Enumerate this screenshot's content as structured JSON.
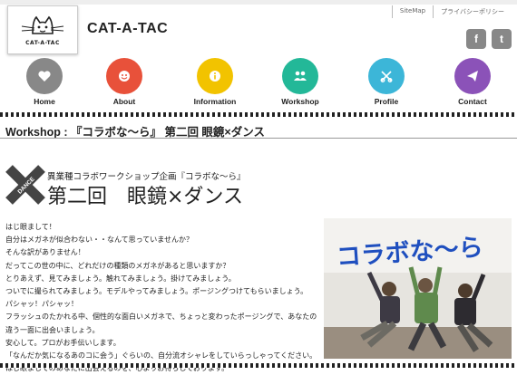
{
  "header": {
    "top_links": [
      "SiteMap",
      "プライバシーポリシー"
    ],
    "logo_text": "CAT-A-TAC",
    "site_title": "CAT-A-TAC",
    "social": [
      {
        "icon": "facebook-icon",
        "glyph": "f"
      },
      {
        "icon": "twitter-icon",
        "glyph": "t"
      }
    ]
  },
  "nav": [
    {
      "label": "Home",
      "icon": "heart-icon",
      "color": "#888888"
    },
    {
      "label": "About",
      "icon": "smiley-icon",
      "color": "#e8513a"
    },
    {
      "label": "Information",
      "icon": "info-icon",
      "color": "#f2c300"
    },
    {
      "label": "Workshop",
      "icon": "people-icon",
      "color": "#23b898"
    },
    {
      "label": "Profile",
      "icon": "scissors-icon",
      "color": "#3cb6d8"
    },
    {
      "label": "Contact",
      "icon": "paper-plane-icon",
      "color": "#8b52b8"
    }
  ],
  "page": {
    "heading": "Workshop : 『コラボな～ら』 第二回 眼鏡×ダンス",
    "badge_text": "DANCE",
    "subtitle": "異業種コラボワークショップ企画『コラボな～ら』",
    "title": "第二回　眼鏡×ダンス",
    "paragraphs": [
      "はじ眼まして！",
      "自分はメガネが似合わない・・なんて思っていませんか？",
      "そんな訳がありません！",
      "だってこの世の中に、どれだけの種類のメガネがあると思いますか？",
      "とりあえず、見てみましょう。触れてみましょう。掛けてみましょう。",
      "ついでに撮られてみましょう。モデルやってみましょう。ポージングつけてもらいましょう。",
      "パシャッ！パシャッ！",
      "フラッシュのたかれる中、個性的な面白いメガネで、ちょっと変わったポージングで、あなたの",
      "違う一面に出会いましょう。",
      "安心して。プロがお手伝いします。",
      "「なんだか気になるあのコに会う」ぐらいの、自分流オシャレをしていらっしゃってください。",
      "はじ眼ましてのあなたに出会えるのを、心よりお待ちしております。"
    ],
    "photo_text": "コラボな～ら"
  }
}
